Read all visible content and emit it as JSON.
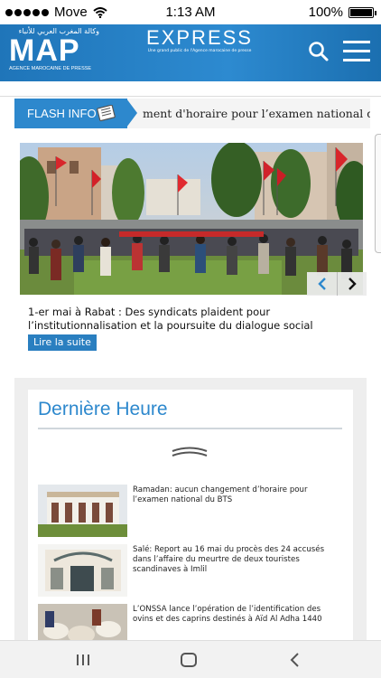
{
  "status_bar": {
    "carrier": "Move",
    "time": "1:13 AM",
    "battery": "100%"
  },
  "header": {
    "logo_arabic": "وكالة المغرب العربي للأنباء",
    "logo_main": "MAP",
    "logo_subtitle": "AGENCE MAROCAINE DE PRESSE",
    "brand": "EXPRESS",
    "brand_tagline": "Une grand public de l'Agence marocaine de presse",
    "search_icon": "search-icon",
    "menu_icon": "hamburger-menu-icon"
  },
  "flash": {
    "label": "FLASH INFO",
    "ticker": "ment d'horaire pour l’examen national du BTS"
  },
  "featured": {
    "headline": "1-er mai à Rabat : Des syndicats plaident pour l’institutionnalisation et la poursuite du dialogue social",
    "read_more": "Lire la suite",
    "prev_icon": "chevron-left-icon",
    "next_icon": "chevron-right-icon"
  },
  "latest": {
    "title": "Dernière Heure",
    "items": [
      {
        "text": "Ramadan: aucun changement d’horaire pour l’examen national du BTS"
      },
      {
        "text": "Salé: Report au 16 mai du procès des 24 accusés dans l’affaire du meurtre de deux touristes scandinaves à Imlil"
      },
      {
        "text": "L’ONSSA lance l’opération de l’identification des ovins et des caprins destinés à Aïd Al Adha 1440"
      }
    ]
  },
  "colors": {
    "brand_blue": "#2d88cd",
    "header_blue": "#1f75b9"
  }
}
